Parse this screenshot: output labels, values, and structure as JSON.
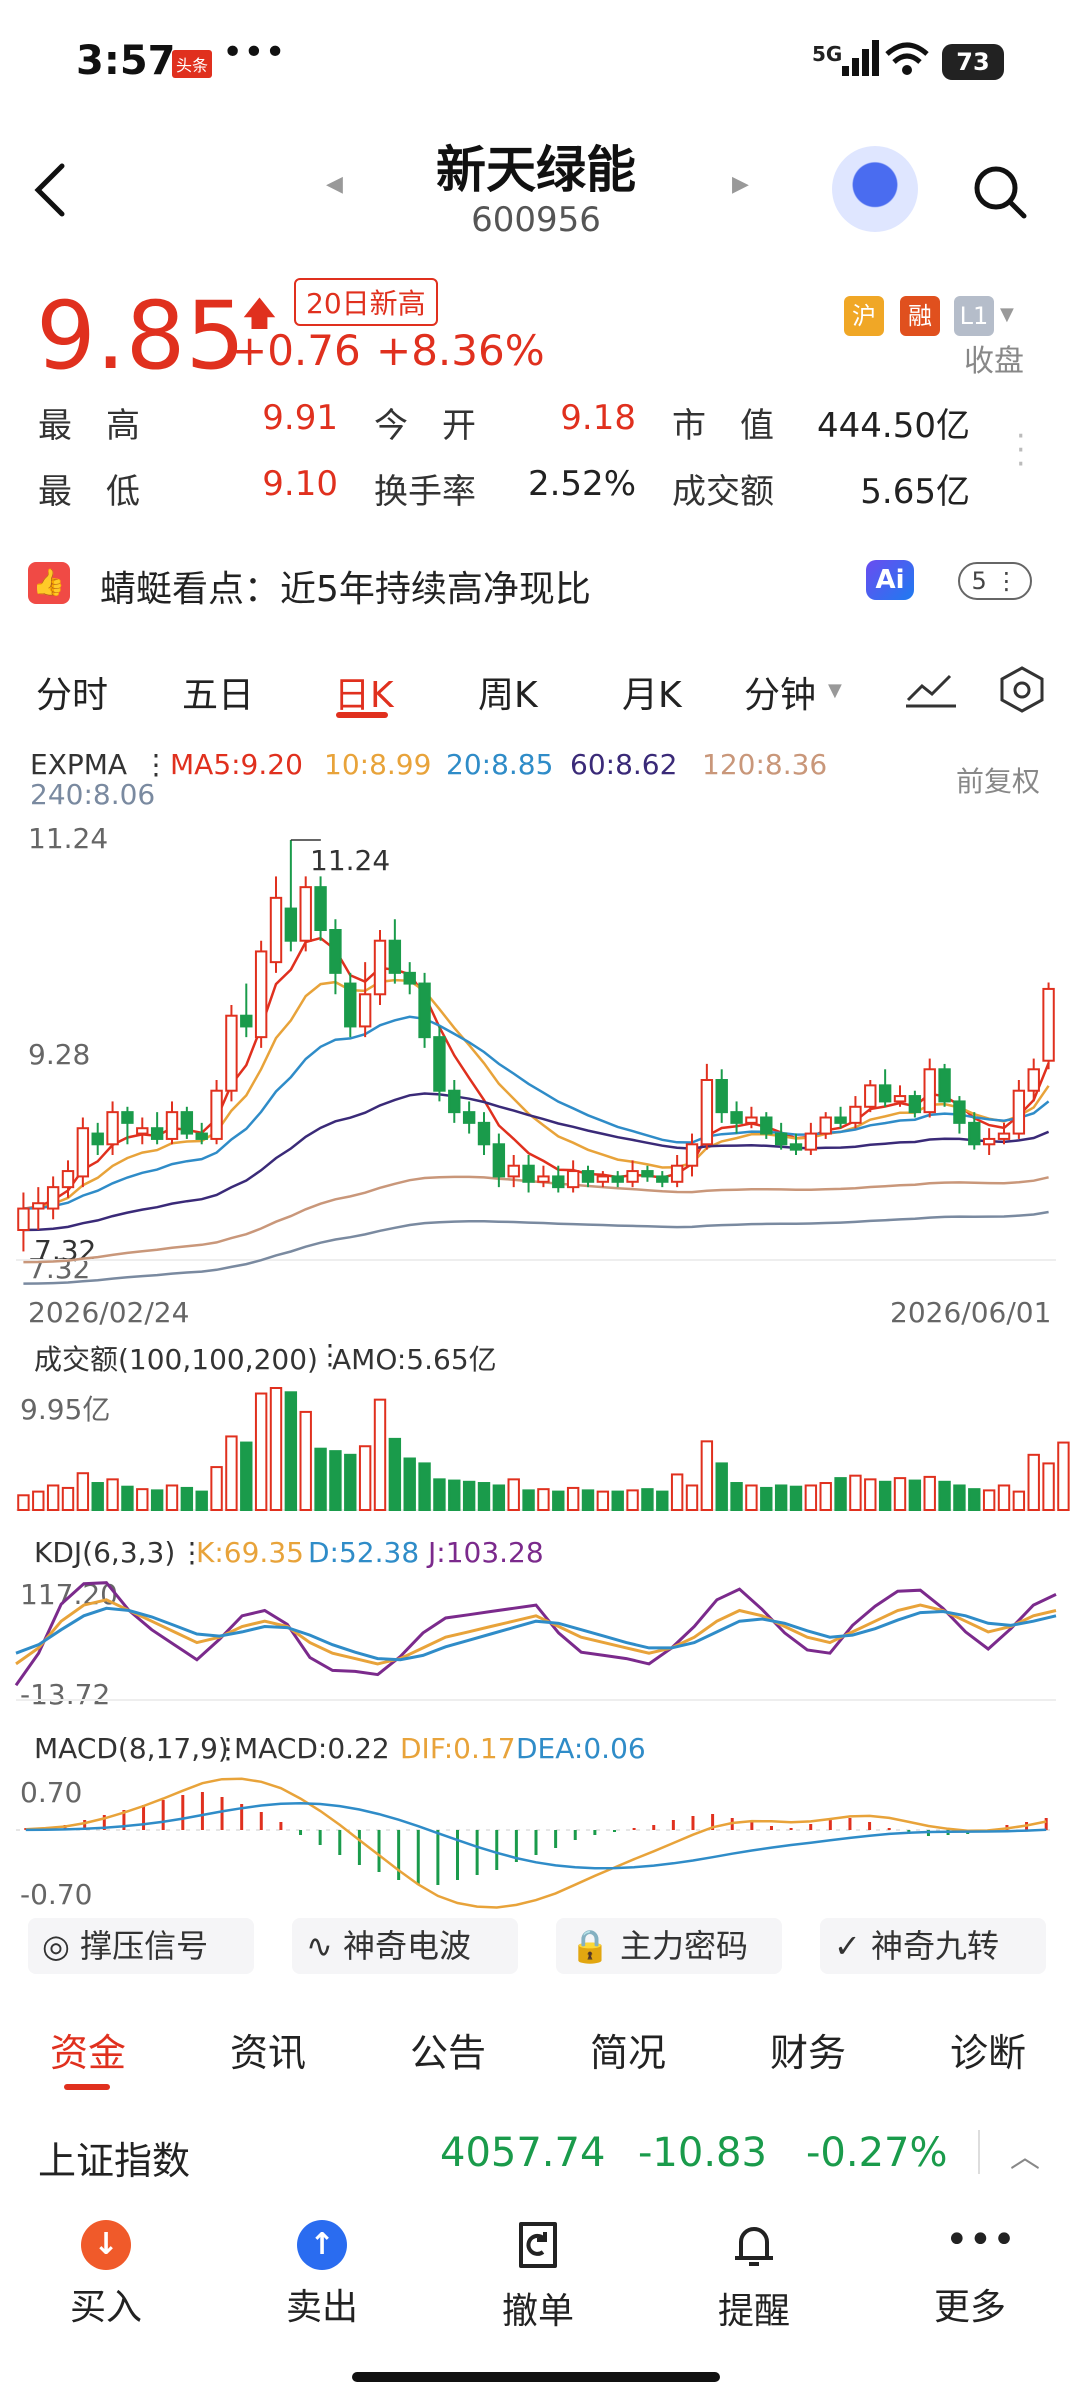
{
  "status_bar": {
    "time": "3:57",
    "app_badge": "头条",
    "dots": "•••",
    "network": "5G",
    "battery": "73"
  },
  "header": {
    "name": "新天绿能",
    "code": "600956"
  },
  "quote": {
    "price": "9.85",
    "change": "+0.76",
    "change_pct": "+8.36%",
    "badge": "20日新高",
    "tags": [
      "沪",
      "融",
      "L1"
    ],
    "status": "收盘",
    "rows": [
      [
        {
          "label": "最　高",
          "value": "9.91"
        },
        {
          "label": "今　开",
          "value": "9.18"
        },
        {
          "label": "市　值",
          "value": "444.50亿"
        }
      ],
      [
        {
          "label": "最　低",
          "value": "9.10"
        },
        {
          "label": "换手率",
          "value": "2.52%"
        },
        {
          "label": "成交额",
          "value": "5.65亿"
        }
      ]
    ]
  },
  "insight": {
    "label": "蜻蜓看点：近5年持续高净现比",
    "ai": "Ai",
    "count": "5"
  },
  "chart_tabs": [
    "分时",
    "五日",
    "日K",
    "周K",
    "月K",
    "分钟"
  ],
  "chart_tabs_active": 2,
  "expma_legend": {
    "title": "EXPMA",
    "ma5": "MA5:9.20",
    "ma10": "10:8.99",
    "ma20": "20:8.85",
    "ma60": "60:8.62",
    "ma120": "120:8.36",
    "ma240": "240:8.06",
    "adjust": "前复权"
  },
  "colors": {
    "up": "#e0301e",
    "down": "#1a9b4b",
    "ma5": "#e0301e",
    "ma10": "#e8a33a",
    "ma20": "#2f8cc8",
    "ma60": "#3a2a78",
    "ma120": "#c9977a",
    "ma240": "#7a8aa0",
    "kdj_k": "#e8a33a",
    "kdj_d": "#2f8cc8",
    "kdj_j": "#7b2a8c"
  },
  "price_axis": {
    "top": "11.24",
    "mid": "9.28",
    "bottom": "7.32",
    "max_label": "11.24",
    "min_label": "7.32",
    "start_date": "2026/02/24",
    "end_date": "2026/06/01"
  },
  "volume": {
    "legend": "成交额(100,100,200)",
    "amo": "AMO:5.65亿",
    "max": "9.95亿"
  },
  "kdj": {
    "legend": "KDJ(6,3,3)",
    "k": "K:69.35",
    "d": "D:52.38",
    "j": "J:103.28",
    "top": "117.20",
    "bottom": "-13.72"
  },
  "macd": {
    "legend": "MACD(8,17,9)",
    "macd": "MACD:0.22",
    "dif": "DIF:0.17",
    "dea": "DEA:0.06",
    "top": "0.70",
    "bottom": "-0.70"
  },
  "chart_data": {
    "type": "candlestick",
    "x_range": [
      "2026/02/24",
      "2026/06/01"
    ],
    "ylim": [
      7.32,
      11.24
    ],
    "candles": [
      {
        "o": 7.6,
        "c": 7.8,
        "h": 7.95,
        "l": 7.4
      },
      {
        "o": 7.8,
        "c": 7.85,
        "h": 8.0,
        "l": 7.6
      },
      {
        "o": 7.8,
        "c": 8.0,
        "h": 8.1,
        "l": 7.7
      },
      {
        "o": 8.0,
        "c": 8.15,
        "h": 8.25,
        "l": 7.9
      },
      {
        "o": 8.1,
        "c": 8.55,
        "h": 8.65,
        "l": 8.0
      },
      {
        "o": 8.5,
        "c": 8.4,
        "h": 8.6,
        "l": 8.3
      },
      {
        "o": 8.4,
        "c": 8.7,
        "h": 8.8,
        "l": 8.3
      },
      {
        "o": 8.7,
        "c": 8.6,
        "h": 8.75,
        "l": 8.4
      },
      {
        "o": 8.5,
        "c": 8.55,
        "h": 8.65,
        "l": 8.4
      },
      {
        "o": 8.55,
        "c": 8.45,
        "h": 8.7,
        "l": 8.4
      },
      {
        "o": 8.45,
        "c": 8.7,
        "h": 8.8,
        "l": 8.4
      },
      {
        "o": 8.7,
        "c": 8.5,
        "h": 8.75,
        "l": 8.45
      },
      {
        "o": 8.5,
        "c": 8.45,
        "h": 8.6,
        "l": 8.4
      },
      {
        "o": 8.45,
        "c": 8.9,
        "h": 9.0,
        "l": 8.4
      },
      {
        "o": 8.9,
        "c": 9.6,
        "h": 9.7,
        "l": 8.8
      },
      {
        "o": 9.6,
        "c": 9.5,
        "h": 9.9,
        "l": 9.4
      },
      {
        "o": 9.4,
        "c": 10.2,
        "h": 10.3,
        "l": 9.3
      },
      {
        "o": 10.1,
        "c": 10.7,
        "h": 10.9,
        "l": 10.0
      },
      {
        "o": 10.6,
        "c": 10.3,
        "h": 11.24,
        "l": 10.2
      },
      {
        "o": 10.3,
        "c": 10.8,
        "h": 10.9,
        "l": 10.2
      },
      {
        "o": 10.8,
        "c": 10.4,
        "h": 10.9,
        "l": 10.3
      },
      {
        "o": 10.4,
        "c": 10.0,
        "h": 10.5,
        "l": 9.8
      },
      {
        "o": 9.9,
        "c": 9.5,
        "h": 10.0,
        "l": 9.4
      },
      {
        "o": 9.5,
        "c": 9.8,
        "h": 10.1,
        "l": 9.4
      },
      {
        "o": 9.8,
        "c": 10.3,
        "h": 10.4,
        "l": 9.7
      },
      {
        "o": 10.3,
        "c": 10.0,
        "h": 10.5,
        "l": 9.9
      },
      {
        "o": 10.0,
        "c": 9.9,
        "h": 10.1,
        "l": 9.8
      },
      {
        "o": 9.9,
        "c": 9.4,
        "h": 10.0,
        "l": 9.3
      },
      {
        "o": 9.4,
        "c": 8.9,
        "h": 9.5,
        "l": 8.8
      },
      {
        "o": 8.9,
        "c": 8.7,
        "h": 9.0,
        "l": 8.6
      },
      {
        "o": 8.7,
        "c": 8.6,
        "h": 8.8,
        "l": 8.5
      },
      {
        "o": 8.6,
        "c": 8.4,
        "h": 8.7,
        "l": 8.3
      },
      {
        "o": 8.4,
        "c": 8.1,
        "h": 8.5,
        "l": 8.0
      },
      {
        "o": 8.1,
        "c": 8.2,
        "h": 8.3,
        "l": 8.0
      },
      {
        "o": 8.2,
        "c": 8.05,
        "h": 8.3,
        "l": 7.95
      },
      {
        "o": 8.05,
        "c": 8.1,
        "h": 8.2,
        "l": 8.0
      },
      {
        "o": 8.1,
        "c": 8.0,
        "h": 8.2,
        "l": 7.95
      },
      {
        "o": 8.0,
        "c": 8.15,
        "h": 8.25,
        "l": 7.95
      },
      {
        "o": 8.15,
        "c": 8.05,
        "h": 8.2,
        "l": 8.0
      },
      {
        "o": 8.05,
        "c": 8.1,
        "h": 8.15,
        "l": 8.0
      },
      {
        "o": 8.1,
        "c": 8.05,
        "h": 8.15,
        "l": 8.0
      },
      {
        "o": 8.05,
        "c": 8.15,
        "h": 8.25,
        "l": 8.0
      },
      {
        "o": 8.15,
        "c": 8.1,
        "h": 8.2,
        "l": 8.05
      },
      {
        "o": 8.1,
        "c": 8.05,
        "h": 8.15,
        "l": 8.0
      },
      {
        "o": 8.05,
        "c": 8.2,
        "h": 8.3,
        "l": 8.0
      },
      {
        "o": 8.2,
        "c": 8.4,
        "h": 8.5,
        "l": 8.1
      },
      {
        "o": 8.4,
        "c": 9.0,
        "h": 9.15,
        "l": 8.35
      },
      {
        "o": 9.0,
        "c": 8.7,
        "h": 9.1,
        "l": 8.6
      },
      {
        "o": 8.7,
        "c": 8.6,
        "h": 8.8,
        "l": 8.5
      },
      {
        "o": 8.6,
        "c": 8.65,
        "h": 8.75,
        "l": 8.55
      },
      {
        "o": 8.65,
        "c": 8.5,
        "h": 8.7,
        "l": 8.45
      },
      {
        "o": 8.5,
        "c": 8.4,
        "h": 8.6,
        "l": 8.35
      },
      {
        "o": 8.4,
        "c": 8.35,
        "h": 8.5,
        "l": 8.3
      },
      {
        "o": 8.35,
        "c": 8.5,
        "h": 8.6,
        "l": 8.3
      },
      {
        "o": 8.5,
        "c": 8.65,
        "h": 8.7,
        "l": 8.45
      },
      {
        "o": 8.65,
        "c": 8.6,
        "h": 8.75,
        "l": 8.55
      },
      {
        "o": 8.6,
        "c": 8.75,
        "h": 8.85,
        "l": 8.55
      },
      {
        "o": 8.75,
        "c": 8.95,
        "h": 9.0,
        "l": 8.7
      },
      {
        "o": 8.95,
        "c": 8.8,
        "h": 9.1,
        "l": 8.75
      },
      {
        "o": 8.8,
        "c": 8.85,
        "h": 8.95,
        "l": 8.75
      },
      {
        "o": 8.85,
        "c": 8.7,
        "h": 8.9,
        "l": 8.65
      },
      {
        "o": 8.7,
        "c": 9.1,
        "h": 9.2,
        "l": 8.65
      },
      {
        "o": 9.1,
        "c": 8.8,
        "h": 9.15,
        "l": 8.75
      },
      {
        "o": 8.8,
        "c": 8.6,
        "h": 8.85,
        "l": 8.5
      },
      {
        "o": 8.6,
        "c": 8.4,
        "h": 8.7,
        "l": 8.35
      },
      {
        "o": 8.4,
        "c": 8.45,
        "h": 8.55,
        "l": 8.3
      },
      {
        "o": 8.45,
        "c": 8.5,
        "h": 8.6,
        "l": 8.4
      },
      {
        "o": 8.5,
        "c": 8.9,
        "h": 9.0,
        "l": 8.45
      },
      {
        "o": 8.9,
        "c": 9.1,
        "h": 9.2,
        "l": 8.8
      },
      {
        "o": 9.18,
        "c": 9.85,
        "h": 9.91,
        "l": 9.1
      }
    ],
    "volume": [
      1.2,
      1.5,
      2.0,
      1.8,
      3.0,
      2.2,
      2.5,
      1.9,
      1.7,
      1.6,
      2.0,
      1.8,
      1.5,
      3.5,
      6.0,
      5.5,
      9.5,
      9.95,
      9.6,
      8.0,
      5.0,
      4.8,
      4.5,
      5.2,
      9.0,
      5.8,
      4.2,
      3.8,
      2.5,
      2.4,
      2.3,
      2.2,
      2.0,
      2.5,
      1.6,
      1.7,
      1.5,
      1.8,
      1.6,
      1.5,
      1.5,
      1.6,
      1.7,
      1.5,
      2.9,
      2.0,
      5.6,
      3.8,
      2.2,
      2.0,
      1.8,
      2.0,
      1.9,
      2.0,
      2.2,
      2.6,
      2.8,
      2.5,
      2.3,
      2.6,
      2.4,
      2.7,
      2.3,
      2.0,
      1.7,
      1.6,
      2.0,
      1.5,
      4.5,
      3.8,
      5.5
    ],
    "kdj": {
      "k": [
        20,
        35,
        60,
        75,
        80,
        70,
        60,
        50,
        40,
        45,
        55,
        60,
        55,
        40,
        30,
        25,
        20,
        25,
        35,
        45,
        50,
        55,
        60,
        65,
        55,
        45,
        40,
        35,
        30,
        35,
        45,
        60,
        70,
        65,
        55,
        45,
        40,
        50,
        60,
        70,
        75,
        70,
        60,
        50,
        55,
        65,
        70
      ],
      "d": [
        30,
        38,
        52,
        65,
        72,
        70,
        64,
        56,
        48,
        46,
        50,
        55,
        54,
        47,
        38,
        31,
        25,
        24,
        28,
        36,
        42,
        48,
        54,
        60,
        58,
        52,
        46,
        40,
        35,
        35,
        40,
        50,
        60,
        62,
        58,
        51,
        45,
        47,
        53,
        61,
        68,
        69,
        65,
        58,
        56,
        60,
        65
      ],
      "j": [
        0,
        30,
        76,
        95,
        96,
        70,
        52,
        38,
        24,
        43,
        65,
        70,
        57,
        26,
        14,
        13,
        10,
        27,
        49,
        63,
        66,
        69,
        72,
        75,
        49,
        31,
        28,
        25,
        20,
        35,
        55,
        80,
        90,
        71,
        49,
        33,
        30,
        56,
        74,
        88,
        89,
        72,
        50,
        34,
        53,
        75,
        85
      ]
    },
    "macd": {
      "hist": [
        0.02,
        0.03,
        0.05,
        0.1,
        0.15,
        0.2,
        0.25,
        0.3,
        0.35,
        0.38,
        0.33,
        0.26,
        0.18,
        0.08,
        -0.05,
        -0.15,
        -0.25,
        -0.35,
        -0.42,
        -0.5,
        -0.55,
        -0.55,
        -0.5,
        -0.45,
        -0.4,
        -0.32,
        -0.25,
        -0.18,
        -0.1,
        -0.05,
        -0.02,
        0.02,
        0.05,
        0.1,
        0.14,
        0.16,
        0.12,
        0.08,
        0.04,
        0.02,
        0.06,
        0.1,
        0.12,
        0.08,
        0.02,
        -0.04,
        -0.06,
        -0.05,
        -0.04,
        0.0,
        0.05,
        0.08,
        0.12
      ]
    }
  },
  "features": [
    "撑压信号",
    "神奇电波",
    "主力密码",
    "神奇九转"
  ],
  "bottom_tabs": [
    "资金",
    "资讯",
    "公告",
    "简况",
    "财务",
    "诊断"
  ],
  "bottom_tabs_active": 0,
  "index_row": {
    "name": "上证指数",
    "value": "4057.74",
    "change": "-10.83",
    "pct": "-0.27%"
  },
  "actions": [
    {
      "label": "买入",
      "icon": "arrow-down-icon"
    },
    {
      "label": "卖出",
      "icon": "arrow-up-icon"
    },
    {
      "label": "撤单",
      "icon": "cancel-order-icon"
    },
    {
      "label": "提醒",
      "icon": "bell-icon"
    },
    {
      "label": "更多",
      "icon": "more-icon"
    }
  ]
}
